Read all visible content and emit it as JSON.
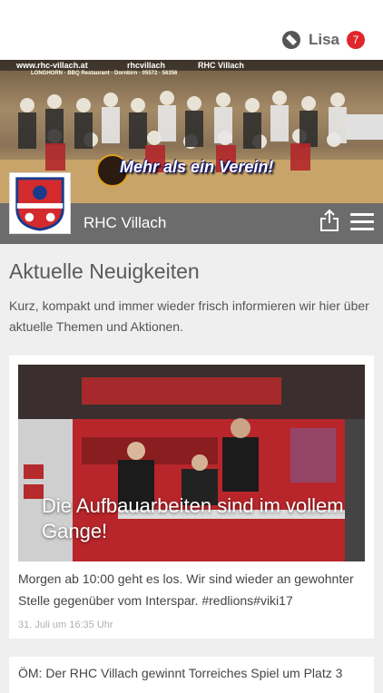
{
  "user": {
    "name": "Lisa",
    "notification_count": "7"
  },
  "hero": {
    "url_text": "www.rhc-villach.at",
    "handle_text": "rhcvillach",
    "fb_text": "RHC Villach",
    "sponsor_text": "LONGHORN · BBQ Restaurant · Dornbirn · 05572 · 56356",
    "slogan": "Mehr als ein Verein!"
  },
  "club": {
    "name": "RHC Villach"
  },
  "page": {
    "title": "Aktuelle Neuigkeiten",
    "intro": "Kurz, kompakt und immer wieder frisch informieren wir hier über aktuelle Themen und Aktionen."
  },
  "news": [
    {
      "headline": "Die Aufbauarbeiten sind im vollem Gange!",
      "text": "Morgen ab 10:00 geht es los. Wir sind wieder an gewohnter Stelle gegenüber vom Interspar. #redlions#viki17",
      "date": "31. Juli um 16:35 Uhr"
    },
    {
      "headline": "ÖM: Der RHC Villach gewinnt Torreiches Spiel um Platz 3"
    }
  ],
  "colors": {
    "accent": "#e0262b",
    "club_bar": "#6c6c6c",
    "background": "#efefef"
  },
  "icons": [
    "app-logo-icon",
    "share-icon",
    "hamburger-menu-icon"
  ]
}
